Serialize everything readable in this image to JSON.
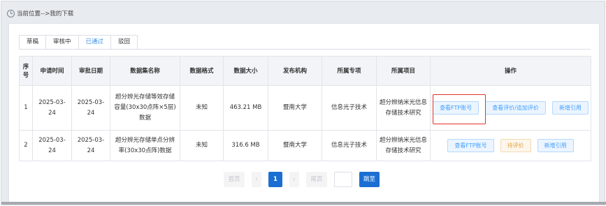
{
  "breadcrumb": {
    "text": "当前位置-->我的下载",
    "icon": "clock-icon"
  },
  "tabs": [
    {
      "label": "草稿",
      "active": false
    },
    {
      "label": "审核中",
      "active": false
    },
    {
      "label": "已通过",
      "active": true
    },
    {
      "label": "驳回",
      "active": false
    }
  ],
  "table": {
    "headers": {
      "index": "序号",
      "apply_date": "申请时间",
      "approve_date": "审批日期",
      "dataset": "数据集名称",
      "format": "数据格式",
      "size": "数据大小",
      "publisher": "发布机构",
      "field": "所属专项",
      "project": "所属项目",
      "ops": "操作"
    },
    "rows": [
      {
        "index": "1",
        "apply_date": "2025-03-24",
        "approve_date": "2025-03-24",
        "dataset": "超分辨光存储等效存储容量(30x30点阵×5层)数据",
        "format": "未知",
        "size": "463.21 MB",
        "publisher": "暨南大学",
        "field": "信息光子技术",
        "project": "超分辨纳米光信息存储技术研究",
        "btn1": "查看FTP账号",
        "btn2": "查看评价/追加评价",
        "btn3": "新增引用"
      },
      {
        "index": "2",
        "apply_date": "2025-03-24",
        "approve_date": "2025-03-24",
        "dataset": "超分辨光存储单点分辨率(30x30点阵)数据",
        "format": "未知",
        "size": "316.6 MB",
        "publisher": "暨南大学",
        "field": "信息光子技术",
        "project": "超分辨纳米光信息存储技术研究",
        "btn1": "查看FTP账号",
        "btn2": "待评价",
        "btn3": "新增引用"
      }
    ]
  },
  "pagination": {
    "first": "首页",
    "prev": "‹",
    "current": "1",
    "next": "›",
    "last": "尾页",
    "page_input": "",
    "go": "跳至"
  },
  "colors": {
    "primary": "#1b6fd3",
    "link": "#409eff",
    "warning": "#e6a23c",
    "highlight": "#e0302d"
  }
}
